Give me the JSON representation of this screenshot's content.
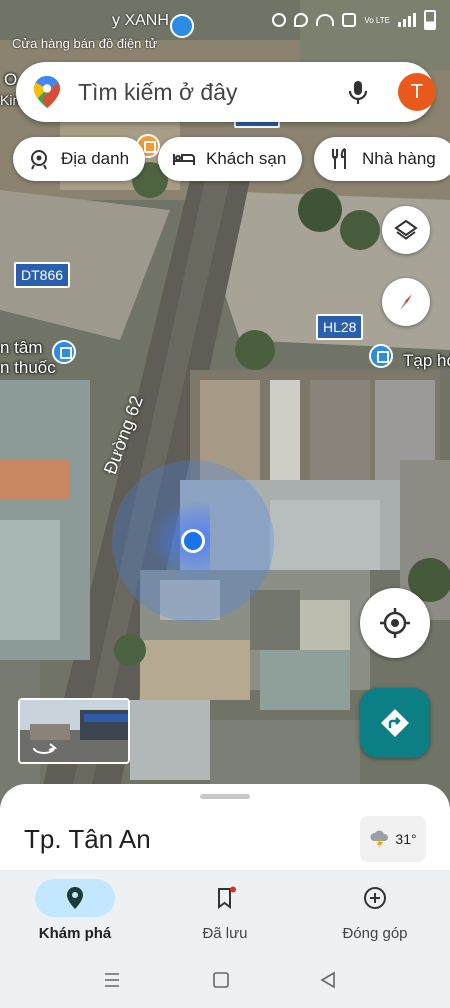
{
  "status_bar": {
    "store_name": "y XANH",
    "store_sub": "Cửa hàng bán đồ điện tử",
    "network_label": "Vo LTE"
  },
  "search": {
    "placeholder": "Tìm kiếm ở đây",
    "avatar_letter": "T"
  },
  "chips": [
    {
      "label": "Địa danh",
      "icon": "landmark-icon"
    },
    {
      "label": "Khách sạn",
      "icon": "bed-icon"
    },
    {
      "label": "Nhà hàng",
      "icon": "fork-knife-icon"
    }
  ],
  "map": {
    "road_shields": [
      "DT866",
      "HL28"
    ],
    "labels": [
      "n tâm",
      "n thuốc",
      "Tạp hó",
      "O",
      "Kin"
    ],
    "street_name": "Đường 62"
  },
  "sheet": {
    "city": "Tp. Tân An",
    "temperature": "31°"
  },
  "nav": [
    {
      "label": "Khám phá",
      "icon": "explore-pin-icon",
      "active": true
    },
    {
      "label": "Đã lưu",
      "icon": "bookmark-icon",
      "active": false
    },
    {
      "label": "Đóng góp",
      "icon": "add-circle-icon",
      "active": false
    }
  ],
  "colors": {
    "accent": "#1a73e8",
    "avatar": "#e8591a",
    "nav_active_pill": "#c2e7ff",
    "nav_fab": "#0c7f84",
    "road_shield": "#2a5fb0"
  }
}
